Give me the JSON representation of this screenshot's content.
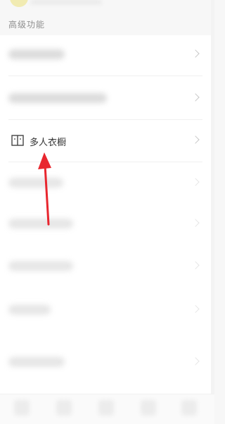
{
  "section": {
    "title": "高级功能"
  },
  "rows": [
    {
      "label": ""
    },
    {
      "label": ""
    },
    {
      "label": "多人衣橱",
      "icon": "book-icon"
    },
    {
      "label": ""
    },
    {
      "label": ""
    },
    {
      "label": ""
    },
    {
      "label": ""
    },
    {
      "label": ""
    }
  ],
  "colors": {
    "background": "#f7f7f7",
    "card": "#ffffff",
    "arrow": "#e8262e",
    "avatar": "#f0e9a6"
  },
  "annotation": {
    "type": "red-arrow",
    "points_to": "多人衣橱"
  }
}
